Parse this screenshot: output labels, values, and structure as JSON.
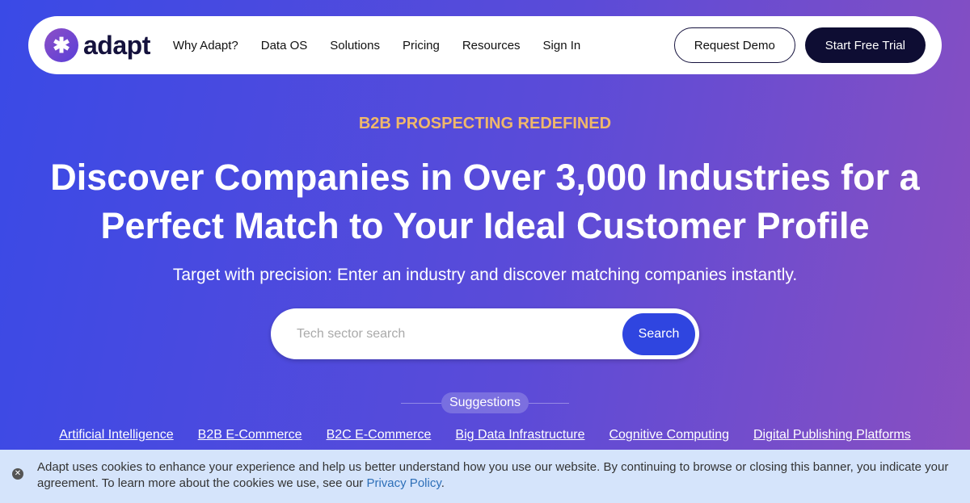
{
  "nav": {
    "logo": "adapt",
    "items": [
      "Why Adapt?",
      "Data OS",
      "Solutions",
      "Pricing",
      "Resources",
      "Sign In"
    ],
    "request_demo": "Request Demo",
    "start_trial": "Start Free Trial"
  },
  "hero": {
    "eyebrow": "B2B PROSPECTING REDEFINED",
    "headline_1": "Discover Companies in Over 3,000 Industries for a",
    "headline_2": "Perfect Match to Your Ideal Customer Profile",
    "subtitle": "Target with precision: Enter an industry and discover matching companies instantly.",
    "search_placeholder": "Tech sector search",
    "search_value": "",
    "search_button": "Search",
    "suggestions_label": "Suggestions",
    "suggestions": [
      "Artificial Intelligence",
      "B2B E-Commerce",
      "B2C E-Commerce",
      "Big Data Infrastructure",
      "Cognitive Computing",
      "Digital Publishing Platforms"
    ]
  },
  "cookie": {
    "text": "Adapt uses cookies to enhance your experience and help us better understand how you use our website. By continuing to browse or closing this banner, you indicate your agreement. To learn more about the cookies we use, see our ",
    "link": "Privacy Policy",
    "end": "."
  }
}
